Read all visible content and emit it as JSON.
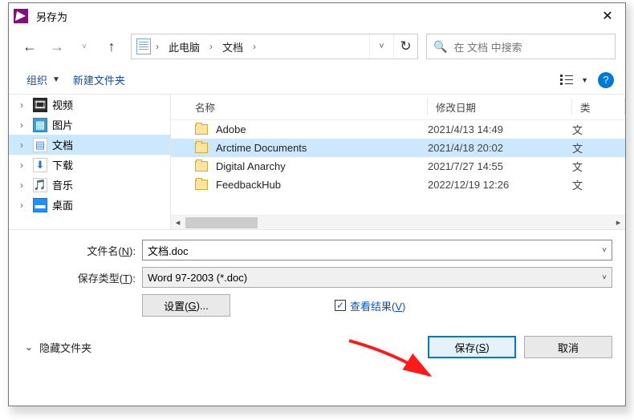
{
  "title": "另存为",
  "breadcrumb": {
    "root": "此电脑",
    "current": "文档"
  },
  "search": {
    "placeholder": "在 文档 中搜索"
  },
  "toolbar": {
    "organize": "组织",
    "newfolder": "新建文件夹"
  },
  "tree": [
    {
      "label": "视频",
      "ico": "🎞",
      "bg": "#2b2b2b",
      "fg": "#fff"
    },
    {
      "label": "图片",
      "ico": "▦",
      "bg": "#3aa0c9",
      "fg": "#fff"
    },
    {
      "label": "文档",
      "ico": "▤",
      "bg": "#fff",
      "fg": "#4b88c7",
      "selected": true
    },
    {
      "label": "下载",
      "ico": "⬇",
      "bg": "#fff",
      "fg": "#2d77c9"
    },
    {
      "label": "音乐",
      "ico": "🎵",
      "bg": "#fff",
      "fg": "#1e90ff"
    },
    {
      "label": "桌面",
      "ico": "▬",
      "bg": "#1e90ff",
      "fg": "#fff"
    }
  ],
  "list": {
    "headers": {
      "name": "名称",
      "date": "修改日期",
      "type": "类"
    },
    "rows": [
      {
        "name": "Adobe",
        "date": "2021/4/13 14:49",
        "type": "文"
      },
      {
        "name": "Arctime Documents",
        "date": "2021/4/18 20:02",
        "type": "文",
        "selected": true
      },
      {
        "name": "Digital Anarchy",
        "date": "2021/7/27 14:55",
        "type": "文"
      },
      {
        "name": "FeedbackHub",
        "date": "2022/12/19 12:26",
        "type": "文"
      }
    ]
  },
  "form": {
    "fname_label_pre": "文件名(",
    "fname_key": "N",
    "fname_label_post": "):",
    "fname_value": "文档.doc",
    "ftype_label_pre": "保存类型(",
    "ftype_key": "T",
    "ftype_label_post": "):",
    "ftype_value": "Word 97-2003 (*.doc)",
    "settings_pre": "设置(",
    "settings_key": "G",
    "settings_post": ")...",
    "view_pre": "查看结果(",
    "view_key": "V",
    "view_post": ")"
  },
  "footer": {
    "hide": "隐藏文件夹",
    "save_pre": "保存(",
    "save_key": "S",
    "save_post": ")",
    "cancel": "取消"
  }
}
